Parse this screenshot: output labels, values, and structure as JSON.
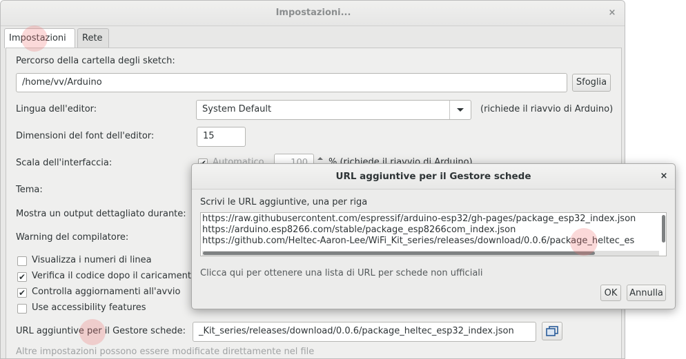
{
  "main_window": {
    "title": "Impostazioni...",
    "close_glyph": "×",
    "tabs": [
      {
        "label": "Impostazioni",
        "selected": true
      },
      {
        "label": "Rete",
        "selected": false
      }
    ],
    "sketchbook": {
      "label": "Percorso della cartella degli sketch:",
      "value": "/home/vv/Arduino",
      "browse_label": "Sfoglia"
    },
    "editor_language": {
      "label": "Lingua dell'editor:",
      "value": "System Default",
      "note": "(richiede il riavvio di Arduino)"
    },
    "font_size": {
      "label": "Dimensioni del font dell'editor:",
      "value": "15"
    },
    "interface_scale": {
      "label": "Scala dell'interfaccia:",
      "auto_label": "Automatico",
      "auto_checked": true,
      "value": "100",
      "note": "% (richiede il riavvio di Arduino)"
    },
    "theme_label": "Tema:",
    "verbose_label": "Mostra un output dettagliato durante:",
    "compiler_warnings_label": "Warning del compilatore:",
    "options": [
      {
        "label": "Visualizza i numeri di linea",
        "checked": false
      },
      {
        "label": "Verifica il codice dopo il caricamento",
        "checked": true
      },
      {
        "label": "Controlla aggiornamenti all'avvio",
        "checked": true
      },
      {
        "label": "Use accessibility features",
        "checked": false
      }
    ],
    "board_urls": {
      "label": "URL aggiuntive per il Gestore schede:",
      "value": "_Kit_series/releases/download/0.0.6/package_heltec_esp32_index.json"
    },
    "footer_note": "Altre impostazioni possono essere modificate direttamente nel file"
  },
  "dialog": {
    "title": "URL aggiuntive per il Gestore schede",
    "close_glyph": "×",
    "instruction": "Scrivi le URL aggiuntive, una per riga",
    "urls": [
      "https://raw.githubusercontent.com/espressif/arduino-esp32/gh-pages/package_esp32_index.json",
      "https://arduino.esp8266.com/stable/package_esp8266com_index.json",
      "https://github.com/Heltec-Aaron-Lee/WiFi_Kit_series/releases/download/0.0.6/package_heltec_es"
    ],
    "link_text": "Clicca qui per ottenere una lista di URL per schede non ufficiali",
    "ok_label": "OK",
    "cancel_label": "Annulla"
  },
  "icons": {
    "dropdown": "chevron-down-icon",
    "window_list": "window-list-icon",
    "checkmark": "checkmark-icon"
  }
}
